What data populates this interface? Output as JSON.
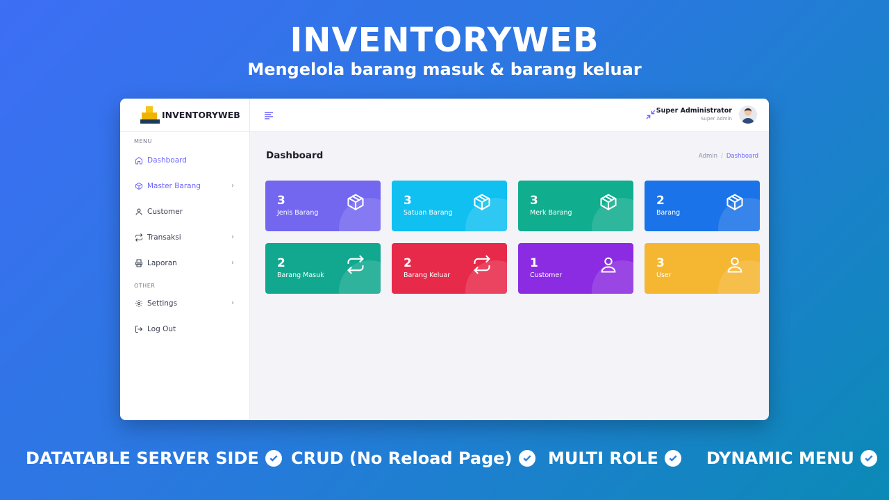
{
  "hero": {
    "title": "INVENTORYWEB",
    "subtitle": "Mengelola barang masuk & barang keluar"
  },
  "app": {
    "brand": "INVENTORYWEB",
    "sidebar": {
      "section_menu": "MENU",
      "section_other": "OTHER",
      "items": [
        {
          "label": "Dashboard",
          "icon": "home-icon",
          "active": true
        },
        {
          "label": "Master Barang",
          "icon": "box-icon",
          "has_children": true
        },
        {
          "label": "Customer",
          "icon": "user-icon"
        },
        {
          "label": "Transaksi",
          "icon": "repeat-icon",
          "has_children": true
        },
        {
          "label": "Laporan",
          "icon": "printer-icon",
          "has_children": true
        },
        {
          "label": "Settings",
          "icon": "gear-icon",
          "has_children": true
        },
        {
          "label": "Log Out",
          "icon": "logout-icon"
        }
      ],
      "chevron": "›"
    },
    "topbar": {
      "user_name": "Super Administrator",
      "user_role": "Super Admin"
    },
    "page": {
      "title": "Dashboard",
      "breadcrumb": [
        "Admin",
        "/",
        "Dashboard"
      ]
    },
    "cards": [
      {
        "count": "3",
        "label": "Jenis Barang",
        "icon": "box-icon",
        "color": "#7367f0"
      },
      {
        "count": "3",
        "label": "Satuan Barang",
        "icon": "box-icon",
        "color": "#0fc0f1"
      },
      {
        "count": "3",
        "label": "Merk Barang",
        "icon": "box-icon",
        "color": "#10ad8f"
      },
      {
        "count": "2",
        "label": "Barang",
        "icon": "box-icon",
        "color": "#1a73e8"
      },
      {
        "count": "2",
        "label": "Barang Masuk",
        "icon": "repeat-icon",
        "color": "#12a88f"
      },
      {
        "count": "2",
        "label": "Barang Keluar",
        "icon": "repeat-icon",
        "color": "#e7294a"
      },
      {
        "count": "1",
        "label": "Customer",
        "icon": "user-icon",
        "color": "#8b2be2"
      },
      {
        "count": "3",
        "label": "User",
        "icon": "user-icon",
        "color": "#f5b632"
      }
    ]
  },
  "features": [
    "DATATABLE SERVER SIDE",
    "CRUD (No Reload Page)",
    "MULTI ROLE",
    "DYNAMIC MENU"
  ],
  "colors": {
    "accent": "#6c63ff",
    "check": "#2f7de0"
  }
}
